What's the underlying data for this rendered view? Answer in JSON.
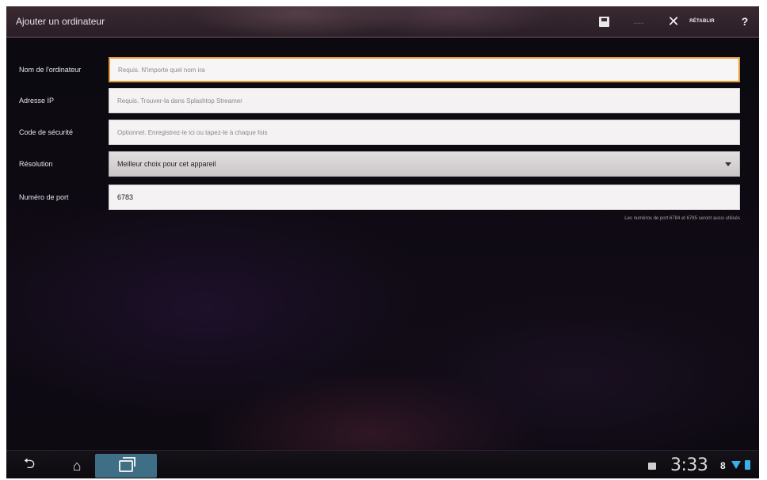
{
  "actionbar": {
    "title": "Ajouter un ordinateur",
    "save_icon": "save-icon",
    "disabled_label": "......",
    "close_glyph": "✕",
    "reset_label": "RÉTABLIR",
    "help_glyph": "?"
  },
  "form": {
    "name": {
      "label": "Nom de l'ordinateur",
      "placeholder": "Requis. N'importe quel nom ira"
    },
    "ip": {
      "label": "Adresse IP",
      "placeholder": "Requis. Trouver-la dans Splashtop Streamer"
    },
    "security": {
      "label": "Code de sécurité",
      "placeholder": "Optionnel. Enregistrez-le ici ou tapez-le à chaque fois"
    },
    "resolution": {
      "label": "Résolution",
      "value": "Meilleur choix pour cet appareil"
    },
    "port": {
      "label": "Numéro de port",
      "value": "6783"
    },
    "port_note": "Les numéros de port 6784 et 6785 seront aussi utilisés"
  },
  "sysbar": {
    "back_glyph": "⮌",
    "home_glyph": "⌂",
    "time": "3:33",
    "extra": "8"
  },
  "colors": {
    "focus": "#e39a3a",
    "status_accent": "#3ab0e8",
    "recent_button": "#3f6f86"
  }
}
